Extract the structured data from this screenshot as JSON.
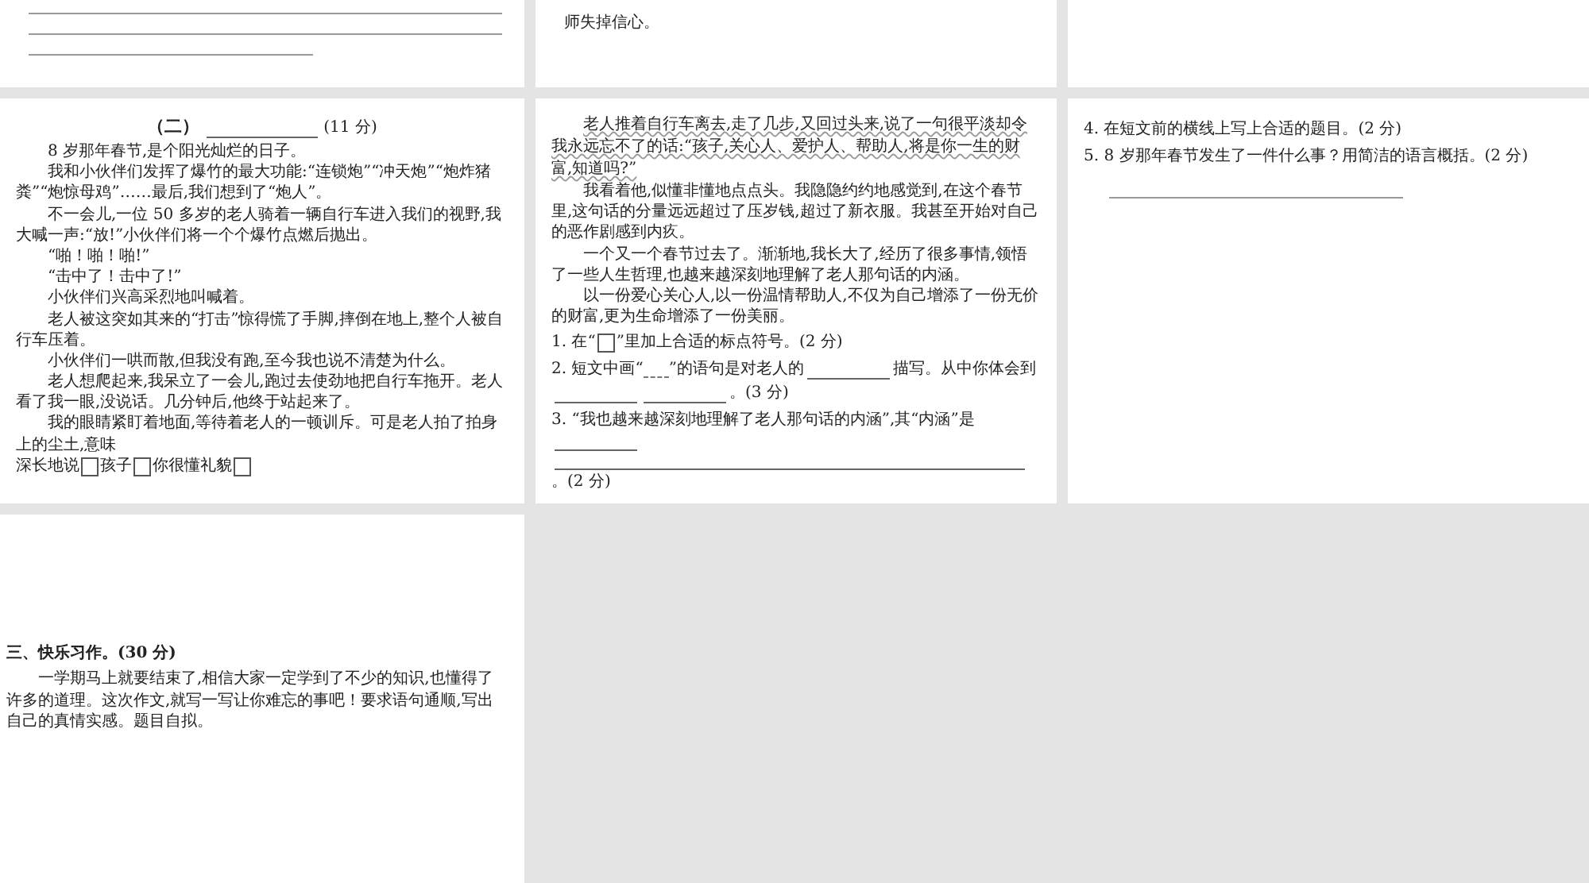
{
  "rows": [
    {
      "pages": [
        {
          "blocks": [
            {
              "kind": "answer-line"
            },
            {
              "kind": "answer-line"
            },
            {
              "kind": "short-line"
            }
          ]
        },
        {
          "blocks": [
            {
              "kind": "text",
              "text": "师失掉信心。"
            }
          ]
        }
      ]
    },
    {
      "pages": [
        {
          "blocks": [
            {
              "kind": "heading",
              "prefix": "（二）",
              "score": "(11 分)"
            },
            {
              "kind": "para",
              "text": "8 岁那年春节,是个阳光灿烂的日子。"
            },
            {
              "kind": "para",
              "text": "我和小伙伴们发挥了爆竹的最大功能:“连锁炮”“冲天炮”“炮炸猪粪”“炮惊母鸡”……最后,我们想到了“炮人”。"
            },
            {
              "kind": "para",
              "text": "不一会儿,一位 50 多岁的老人骑着一辆自行车进入我们的视野,我大喊一声:“放!”小伙伴们将一个个爆竹点燃后抛出。"
            },
            {
              "kind": "para",
              "text": "“啪！啪！啪!”"
            },
            {
              "kind": "para",
              "text": "“击中了！击中了!”"
            },
            {
              "kind": "para",
              "text": "小伙伴们兴高采烈地叫喊着。"
            },
            {
              "kind": "para",
              "text": "老人被这突如其来的“打击”惊得慌了手脚,摔倒在地上,整个人被自行车压着。"
            },
            {
              "kind": "para",
              "text": "小伙伴们一哄而散,但我没有跑,至今我也说不清楚为什么。"
            },
            {
              "kind": "para",
              "text": "老人想爬起来,我呆立了一会儿,跑过去使劲地把自行车拖开。老人看了我一眼,没说话。几分钟后,他终于站起来了。"
            },
            {
              "kind": "para",
              "text": "我的眼睛紧盯着地面,等待着老人的一顿训斥。可是老人拍了拍身上的尘土,意味"
            },
            {
              "kind": "segments",
              "segments": [
                {
                  "kind": "text",
                  "text": "深长地说"
                },
                {
                  "kind": "box"
                },
                {
                  "kind": "text",
                  "text": "孩子"
                },
                {
                  "kind": "box"
                },
                {
                  "kind": "text",
                  "text": "你很懂礼貌"
                },
                {
                  "kind": "box"
                }
              ]
            }
          ]
        },
        {
          "blocks": [
            {
              "kind": "underlined",
              "text": "老人推着自行车离去,走了几步,又回过头来,说了一句很平淡却令我永远忘不了的话:“孩子,关心人、爱护人、帮助人,将是你一生的财富,知道吗?”"
            },
            {
              "kind": "para",
              "text": "我看着他,似懂非懂地点点头。我隐隐约约地感觉到,在这个春节里,这句话的分量远远超过了压岁钱,超过了新衣服。我甚至开始对自己的恶作剧感到内疚。"
            },
            {
              "kind": "para",
              "text": "一个又一个春节过去了。渐渐地,我长大了,经历了很多事情,领悟了一些人生哲理,也越来越深刻地理解了老人那句话的内涵。"
            },
            {
              "kind": "para",
              "text": "以一份爱心关心人,以一份温情帮助人,不仅为自己增添了一份无价的财富,更为生命增添了一份美丽。"
            },
            {
              "kind": "question",
              "segments": [
                {
                  "kind": "text",
                  "text": "1. 在“"
                },
                {
                  "kind": "box"
                },
                {
                  "kind": "text",
                  "text": "”里加上合适的标点符号。(2 分)"
                }
              ]
            },
            {
              "kind": "question",
              "segments": [
                {
                  "kind": "text",
                  "text": "2. 短文中画“"
                },
                {
                  "kind": "mark-line"
                },
                {
                  "kind": "text",
                  "text": "”的语句是对老人的"
                },
                {
                  "kind": "line"
                },
                {
                  "kind": "text",
                  "text": "描写。从中你体会到"
                },
                {
                  "kind": "line"
                },
                {
                  "kind": "line"
                },
                {
                  "kind": "text",
                  "text": "。(3 分)"
                }
              ]
            },
            {
              "kind": "question",
              "segments": [
                {
                  "kind": "text",
                  "text": "3. “我也越来越深刻地理解了老人那句话的内涵”,其“内涵”是"
                },
                {
                  "kind": "line"
                },
                {
                  "kind": "full-line"
                },
                {
                  "kind": "text",
                  "text": "。(2 分)"
                }
              ]
            }
          ]
        },
        {
          "blocks": [
            {
              "kind": "question",
              "segments": [
                {
                  "kind": "text",
                  "text": "4. 在短文前的横线上写上合适的题目。(2 分)"
                }
              ]
            },
            {
              "kind": "question",
              "segments": [
                {
                  "kind": "text",
                  "text": "5. 8 岁那年春节发生了一件什么事？用简洁的语言概括。(2 分)"
                }
              ]
            },
            {
              "kind": "short-line"
            }
          ]
        }
      ]
    },
    {
      "pages": [
        {
          "blocks": [
            {
              "kind": "section",
              "text": "三、快乐习作。(30 分)"
            },
            {
              "kind": "para",
              "text": "一学期马上就要结束了,相信大家一定学到了不少的知识,也懂得了许多的道理。这次作文,就写一写让你难忘的事吧！要求语句通顺,写出自己的真情实感。题目自拟。"
            }
          ]
        }
      ]
    }
  ]
}
